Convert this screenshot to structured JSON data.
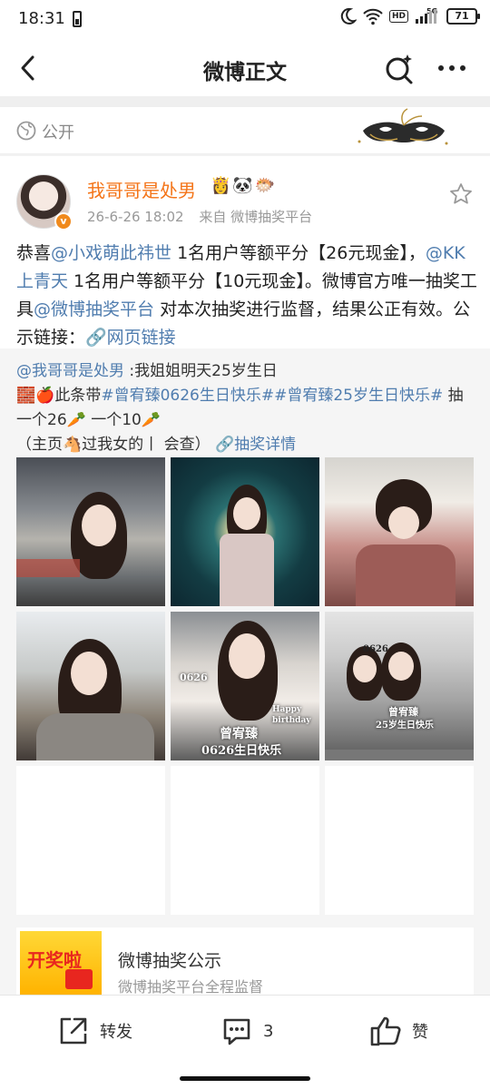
{
  "status": {
    "time": "18:31",
    "network": "5G",
    "battery": "71",
    "hd": "HD"
  },
  "navbar": {
    "title": "微博正文",
    "icons": [
      "back-arrow-icon",
      "search-sparkle-icon",
      "more-dots-icon"
    ]
  },
  "visibility": {
    "label": "公开",
    "icon": "globe-icon"
  },
  "post": {
    "author": "我哥哥是处男",
    "author_emojis": "👸🐼🐡",
    "time": "26-6-26 18:02",
    "source": "来自 微博抽奖平台",
    "text_parts": [
      {
        "t": "恭喜",
        "link": false
      },
      {
        "t": "@小戏萌此祎世",
        "link": true
      },
      {
        "t": " 1名用户等额平分【26元现金】，",
        "link": false
      },
      {
        "t": "@KK上青天",
        "link": true
      },
      {
        "t": " 1名用户等额平分【10元现金】。微博官方唯一抽奖工具",
        "link": false
      },
      {
        "t": "@微博抽奖平台",
        "link": true
      },
      {
        "t": " 对本次抽奖进行监督，结果公正有效。公示链接：",
        "link": false
      },
      {
        "t": "🔗网页链接",
        "link": true
      }
    ]
  },
  "repost": {
    "parts": [
      {
        "t": "@我哥哥是处男",
        "link": true
      },
      {
        "t": " :我姐姐明天25岁生日",
        "link": false
      },
      {
        "t": "\n🧱🍎此条带",
        "link": false
      },
      {
        "t": "#曾宥臻0626生日快乐#",
        "link": true
      },
      {
        "t": "#曾宥臻25岁生日快乐#",
        "link": true
      },
      {
        "t": " 抽一个26🥕 一个10🥕\n（主页🐴过我女的丨 会查） ",
        "link": false
      },
      {
        "t": "🔗抽奖详情",
        "link": true
      }
    ],
    "image_captions": {
      "img5_date": "0626",
      "img5_happy": "Happy birthday",
      "img5_line1": "曾宥臻",
      "img5_line2": "0626生日快乐",
      "img6_date": "0626",
      "img6_line1": "曾宥臻",
      "img6_line2": "25岁生日快乐"
    }
  },
  "lottery_card": {
    "title": "微博抽奖公示",
    "subtitle": "微博抽奖平台全程监督",
    "thumb_text": "开奖啦"
  },
  "bottom": {
    "repost": "转发",
    "comments": "3",
    "like": "赞"
  },
  "colors": {
    "link": "#507daf",
    "username": "#f47418",
    "accent": "#f08a1d"
  }
}
